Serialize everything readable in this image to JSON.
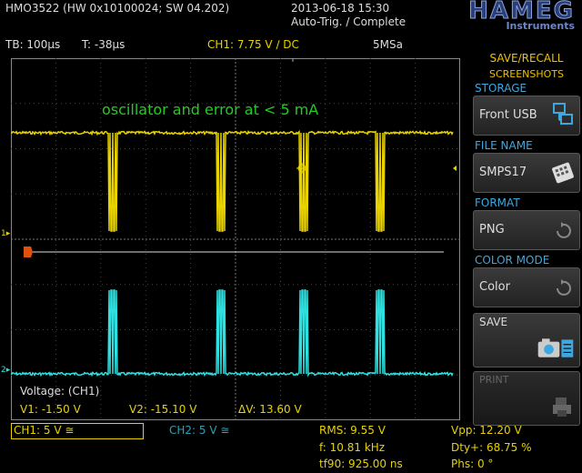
{
  "header": {
    "device_id": "HMO3522 (HW 0x10100024; SW 04.202)",
    "datetime": "2013-06-18 15:30",
    "trigger_status": "Auto-Trig. / Complete",
    "brand": "HAMEG",
    "brand_sub": "Instruments"
  },
  "status_bar": {
    "timebase": "TB: 100µs",
    "trigger_time": "T: -38µs",
    "ch1_trigger": "CH1: 7.75 V ∕ DC",
    "sample_rate": "5MSa"
  },
  "annotation": "oscillator and error at  < 5 mA",
  "cursor_readout": {
    "title": "Voltage: (CH1)",
    "v1": "V1: -1.50 V",
    "v2": "V2: -15.10 V",
    "dv": "ΔV: 13.60 V"
  },
  "side_menu": {
    "title_line1": "SAVE/RECALL",
    "title_line2": "SCREENSHOTS",
    "storage_label": "STORAGE",
    "storage_value": "Front USB",
    "filename_label": "FILE NAME",
    "filename_value": "SMPS17",
    "format_label": "FORMAT",
    "format_value": "PNG",
    "colormode_label": "COLOR MODE",
    "colormode_value": "Color",
    "save_label": "SAVE",
    "print_label": "PRINT"
  },
  "bottom": {
    "ch1_scale": "CH1: 5 V ≅",
    "ch2_scale": "CH2: 5 V ≅",
    "rms": "RMS: 9.55 V",
    "freq": "f: 10.81 kHz",
    "tf90": "tf90: 925.00 ns",
    "vpp": "Vpp: 12.20 V",
    "duty": "Dty+: 68.75 %",
    "phase": "Phs: 0 °"
  },
  "colors": {
    "ch1": "#e8d200",
    "ch2": "#2ee0e0",
    "menu_title": "#f0c000",
    "menu_label": "#3fa7e0",
    "annotation": "#22cc22"
  },
  "icons": {
    "storage": "usb-storage-icon",
    "filename": "keyboard-icon",
    "save": "camera-icon",
    "print": "printer-icon",
    "format_cycle": "cycle-arrow-icon",
    "colormode_cycle": "cycle-arrow-icon"
  }
}
